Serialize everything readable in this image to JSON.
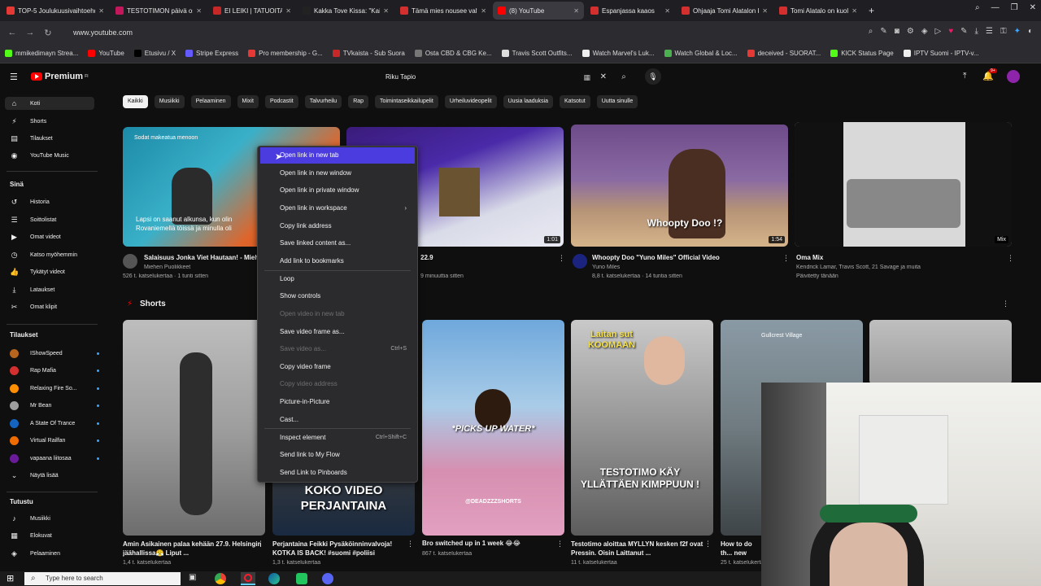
{
  "tabs": [
    {
      "label": "TOP-5 Joulukuusivaihtoehdot",
      "color": "#e53935"
    },
    {
      "label": "TESTOTIMON päivä osa 1",
      "color": "#c2185b"
    },
    {
      "label": "EI LEIKI | TATUOITAVAKSI",
      "color": "#c62828"
    },
    {
      "label": "Kakka Tove Kissa: \"Kaiki",
      "color": "#222222"
    },
    {
      "label": "Tämä mies nousee valtaan",
      "color": "#d32f2f"
    },
    {
      "label": "(8) YouTube",
      "color": "#ff0000"
    },
    {
      "label": "Espanjassa kaaos",
      "color": "#d32f2f"
    },
    {
      "label": "Ohjaaja Tomi Alatalon kuolema",
      "color": "#d32f2f"
    },
    {
      "label": "Tomi Alatalo on kuollut",
      "color": "#d32f2f"
    }
  ],
  "url": "www.youtube.com",
  "bookmarks": [
    {
      "label": "mmikedimayn Strea...",
      "color": "#53fc18"
    },
    {
      "label": "YouTube",
      "color": "#ff0000"
    },
    {
      "label": "Etusivu / X",
      "color": "#000000"
    },
    {
      "label": "Stripe Express",
      "color": "#635bff"
    },
    {
      "label": "Pro membership - G...",
      "color": "#e53935"
    },
    {
      "label": "TVkaista - Sub Suora",
      "color": "#c62828"
    },
    {
      "label": "Osta CBD & CBG Ke...",
      "color": "#777777"
    },
    {
      "label": "Travis Scott Outfits...",
      "color": "#dddddd"
    },
    {
      "label": "Watch Marvel's Luk...",
      "color": "#eeeeee"
    },
    {
      "label": "Watch Global & Loc...",
      "color": "#4caf50"
    },
    {
      "label": "deceived - SUORAT...",
      "color": "#e53935"
    },
    {
      "label": "KICK Status Page",
      "color": "#53fc18"
    },
    {
      "label": "IPTV Suomi - IPTV-v...",
      "color": "#eeeeee"
    }
  ],
  "header": {
    "logo_text": "Premium",
    "logo_sup": "FI",
    "search_value": "Riku Tapio",
    "notif_count": "9+"
  },
  "chips": [
    "Kaikki",
    "Musiikki",
    "Pelaaminen",
    "Mixit",
    "Podcastit",
    "Talvurheilu",
    "Rap",
    "Toimintaseikkailupelit",
    "Urheiluvideopelit",
    "Uusia laaduksia",
    "Katsotut",
    "Uutta sinulle"
  ],
  "sidebar": {
    "main": [
      {
        "label": "Koti",
        "icon": "⌂"
      },
      {
        "label": "Shorts",
        "icon": "⚡"
      },
      {
        "label": "Tilaukset",
        "icon": "▤"
      },
      {
        "label": "YouTube Music",
        "icon": "◉"
      }
    ],
    "you_heading": "Sinä",
    "you": [
      {
        "label": "Historia",
        "icon": "↺"
      },
      {
        "label": "Soittolistat",
        "icon": "☰"
      },
      {
        "label": "Omat videot",
        "icon": "▶"
      },
      {
        "label": "Katso myöhemmin",
        "icon": "◷"
      },
      {
        "label": "Tykätyt videot",
        "icon": "👍"
      },
      {
        "label": "Lataukset",
        "icon": "⤓"
      },
      {
        "label": "Omat klipit",
        "icon": "✂"
      }
    ],
    "subs_heading": "Tilaukset",
    "subs": [
      {
        "label": "IShowSpeed",
        "color": "#b5651d"
      },
      {
        "label": "Rap Mafia",
        "color": "#d32f2f"
      },
      {
        "label": "Relaxing Fire So...",
        "color": "#ff8f00"
      },
      {
        "label": "Mr Bean",
        "color": "#9e9e9e"
      },
      {
        "label": "A State Of Trance",
        "color": "#1565c0"
      },
      {
        "label": "Virtual Railfan",
        "color": "#ef6c00"
      },
      {
        "label": "vapaana liitosaa",
        "color": "#6a1b9a"
      }
    ],
    "show_more": "Näytä lisää",
    "explore_heading": "Tutustu",
    "explore": [
      {
        "label": "Musiikki",
        "icon": "♪"
      },
      {
        "label": "Elokuvat",
        "icon": "▦"
      },
      {
        "label": "Pelaaminen",
        "icon": "◈"
      }
    ]
  },
  "videos": [
    {
      "title": "Salaisuus Jonka Viet Hautaan! - Miehe",
      "channel": "Miehen Puolikkeet",
      "meta": "526 t. katselukertaa · 1 tunti sitten",
      "thumb_caption": "Lapsi on saanut alkunsa, kun olin Rovaniemellä töissä ja minulla oli",
      "overlay": "Sodat makeatua menoon"
    },
    {
      "title": "",
      "channel": "",
      "meta": "9 minuuttia sitten",
      "title_suffix": "22.9",
      "duration": "1:01"
    },
    {
      "title": "Whoopty Doo \"Yuno Miles\" Official Video",
      "channel": "Yuno Miles",
      "meta": "8,8 t. katselukertaa · 14 tuntia sitten",
      "thumb_caption": "Whoopty Doo !?",
      "duration": "1:54"
    },
    {
      "title": "Oma Mix",
      "channel": "Kendrick Lamar, Travis Scott, 21 Savage ja muita",
      "meta": "Päivitetty tänään",
      "duration": "Mix"
    }
  ],
  "shorts_heading": "Shorts",
  "shorts": [
    {
      "title": "Amin Asikainen palaa kehään 27.9. Helsingin jäähallissa😤 Liput ...",
      "meta": "1,4 t. katselukertaa",
      "caption": ""
    },
    {
      "title": "Perjantaina Feikki Pysäköinninvalvoja! KOTKA IS BACK! #suomi #poliisi",
      "meta": "1,3 t. katselukertaa",
      "caption": "KOKO VIDEO PERJANTAINA"
    },
    {
      "title": "Bro switched up in 1 week 😂😂",
      "meta": "867 t. katselukertaa",
      "caption": "*PICKS UP WATER*",
      "watermark": "@DEADZZZSHORTS"
    },
    {
      "title": "Testotimo aloittaa MYLLYN kesken f2f ovat Pressin. Oisin Laittanut ...",
      "meta": "11 t. katselukertaa",
      "caption_top": "Laitan sut KOOMAAN",
      "caption": "TESTOTIMO KÄY YLLÄTTÄEN KIMPPUUN !"
    },
    {
      "title": "How to do th... new skate #f...",
      "meta": "25 t. katselukertaa",
      "caption": "",
      "overlay": "Gullcrest Village"
    },
    {
      "title": "",
      "meta": "",
      "caption": ""
    }
  ],
  "context_menu": [
    {
      "label": "Open link in new tab",
      "state": "highlight"
    },
    {
      "label": "Open link in new window",
      "state": "normal"
    },
    {
      "label": "Open link in private window",
      "state": "normal"
    },
    {
      "label": "Open link in workspace",
      "state": "normal",
      "submenu": true
    },
    {
      "label": "Copy link address",
      "state": "normal"
    },
    {
      "label": "Save linked content as...",
      "state": "normal"
    },
    {
      "label": "Add link to bookmarks",
      "state": "normal"
    },
    {
      "label": "Loop",
      "state": "normal"
    },
    {
      "label": "Show controls",
      "state": "normal"
    },
    {
      "label": "Open video in new tab",
      "state": "disabled"
    },
    {
      "label": "Save video frame as...",
      "state": "normal"
    },
    {
      "label": "Save video as...",
      "state": "disabled",
      "shortcut": "Ctrl+S"
    },
    {
      "label": "Copy video frame",
      "state": "normal"
    },
    {
      "label": "Copy video address",
      "state": "disabled"
    },
    {
      "label": "Picture-in-Picture",
      "state": "normal"
    },
    {
      "label": "Cast...",
      "state": "normal"
    },
    {
      "label": "Inspect element",
      "state": "normal",
      "shortcut": "Ctrl+Shift+C"
    },
    {
      "label": "Send link to My Flow",
      "state": "normal"
    },
    {
      "label": "Send Link to Pinboards",
      "state": "normal"
    }
  ],
  "taskbar": {
    "search_placeholder": "Type here to search"
  },
  "colors": {
    "background": "#0f0f0f",
    "menu_bg": "#2b2b2e",
    "menu_highlight": "#4b3ce0",
    "yt_red": "#ff0000"
  }
}
